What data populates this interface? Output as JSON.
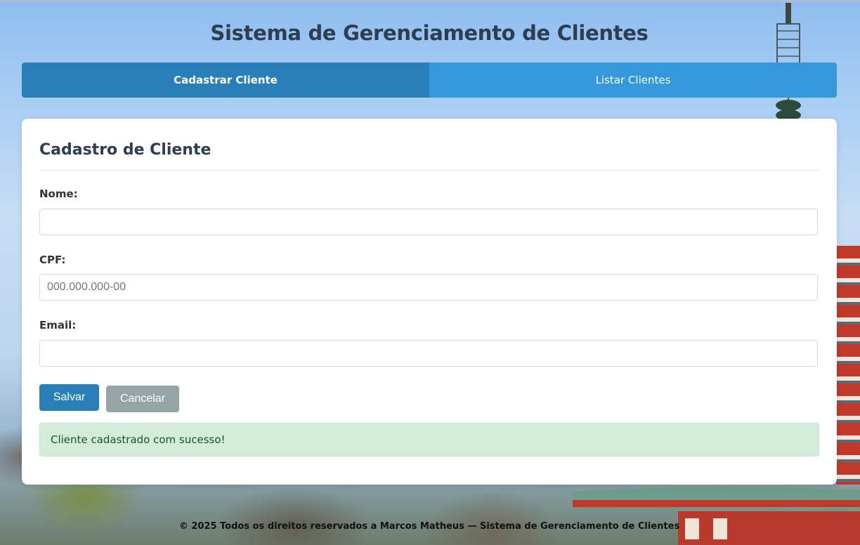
{
  "header": {
    "title": "Sistema de Gerenciamento de Clientes"
  },
  "tabs": [
    {
      "label": "Cadastrar Cliente",
      "active": true
    },
    {
      "label": "Listar Clientes",
      "active": false
    }
  ],
  "form": {
    "heading": "Cadastro de Cliente",
    "fields": {
      "nome": {
        "label": "Nome:",
        "value": "",
        "placeholder": ""
      },
      "cpf": {
        "label": "CPF:",
        "value": "",
        "placeholder": "000.000.000-00"
      },
      "email": {
        "label": "Email:",
        "value": "",
        "placeholder": ""
      }
    },
    "save_label": "Salvar",
    "cancel_label": "Cancelar",
    "success_message": "Cliente cadastrado com sucesso!"
  },
  "footer": {
    "text": "© 2025 Todos os direitos reservados a Marcos Matheus — Sistema de Gerenciamento de Clientes"
  },
  "colors": {
    "primary": "#2980b9",
    "tab_inactive": "#3498db",
    "secondary": "#95a5a6",
    "success_bg": "#d4edda",
    "success_text": "#155724",
    "heading": "#2c3e50"
  }
}
